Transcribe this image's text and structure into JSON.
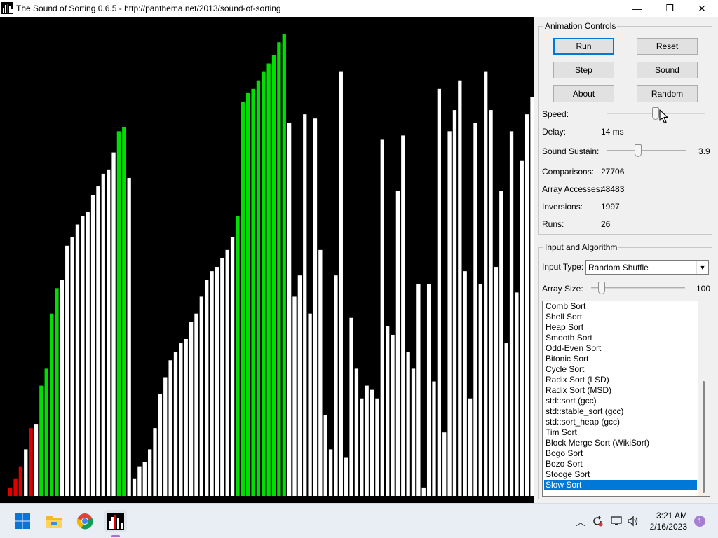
{
  "window": {
    "title": "The Sound of Sorting 0.6.5 - http://panthema.net/2013/sound-of-sorting",
    "minimize": "—",
    "restore": "❐",
    "close": "✕"
  },
  "colors": {
    "bar_default": "#ffffff",
    "bar_red": "#e00000",
    "bar_green": "#00e000",
    "accent": "#0078d7"
  },
  "visualization": {
    "bars": [
      {
        "v": 2,
        "c": "red"
      },
      {
        "v": 4,
        "c": "red"
      },
      {
        "v": 7,
        "c": "red"
      },
      {
        "v": 11,
        "c": "white"
      },
      {
        "v": 16,
        "c": "red"
      },
      {
        "v": 17,
        "c": "white"
      },
      {
        "v": 26,
        "c": "green"
      },
      {
        "v": 30,
        "c": "green"
      },
      {
        "v": 43,
        "c": "green"
      },
      {
        "v": 49,
        "c": "green"
      },
      {
        "v": 51,
        "c": "white"
      },
      {
        "v": 59,
        "c": "white"
      },
      {
        "v": 61,
        "c": "white"
      },
      {
        "v": 64,
        "c": "white"
      },
      {
        "v": 66,
        "c": "white"
      },
      {
        "v": 67,
        "c": "white"
      },
      {
        "v": 71,
        "c": "white"
      },
      {
        "v": 73,
        "c": "white"
      },
      {
        "v": 76,
        "c": "white"
      },
      {
        "v": 77,
        "c": "white"
      },
      {
        "v": 81,
        "c": "white"
      },
      {
        "v": 86,
        "c": "green"
      },
      {
        "v": 87,
        "c": "green"
      },
      {
        "v": 75,
        "c": "white"
      },
      {
        "v": 4,
        "c": "white"
      },
      {
        "v": 7,
        "c": "white"
      },
      {
        "v": 8,
        "c": "white"
      },
      {
        "v": 11,
        "c": "white"
      },
      {
        "v": 16,
        "c": "white"
      },
      {
        "v": 24,
        "c": "white"
      },
      {
        "v": 28,
        "c": "white"
      },
      {
        "v": 32,
        "c": "white"
      },
      {
        "v": 34,
        "c": "white"
      },
      {
        "v": 36,
        "c": "white"
      },
      {
        "v": 37,
        "c": "white"
      },
      {
        "v": 41,
        "c": "white"
      },
      {
        "v": 43,
        "c": "white"
      },
      {
        "v": 47,
        "c": "white"
      },
      {
        "v": 51,
        "c": "white"
      },
      {
        "v": 53,
        "c": "white"
      },
      {
        "v": 54,
        "c": "white"
      },
      {
        "v": 56,
        "c": "white"
      },
      {
        "v": 58,
        "c": "white"
      },
      {
        "v": 61,
        "c": "white"
      },
      {
        "v": 66,
        "c": "green"
      },
      {
        "v": 93,
        "c": "green"
      },
      {
        "v": 95,
        "c": "green"
      },
      {
        "v": 96,
        "c": "green"
      },
      {
        "v": 98,
        "c": "green"
      },
      {
        "v": 100,
        "c": "green"
      },
      {
        "v": 102,
        "c": "green"
      },
      {
        "v": 104,
        "c": "green"
      },
      {
        "v": 107,
        "c": "green"
      },
      {
        "v": 109,
        "c": "green"
      },
      {
        "v": 88,
        "c": "white"
      },
      {
        "v": 47,
        "c": "white"
      },
      {
        "v": 52,
        "c": "white"
      },
      {
        "v": 90,
        "c": "white"
      },
      {
        "v": 43,
        "c": "white"
      },
      {
        "v": 89,
        "c": "white"
      },
      {
        "v": 58,
        "c": "white"
      },
      {
        "v": 19,
        "c": "white"
      },
      {
        "v": 11,
        "c": "white"
      },
      {
        "v": 52,
        "c": "white"
      },
      {
        "v": 100,
        "c": "white"
      },
      {
        "v": 9,
        "c": "white"
      },
      {
        "v": 42,
        "c": "white"
      },
      {
        "v": 30,
        "c": "white"
      },
      {
        "v": 23,
        "c": "white"
      },
      {
        "v": 26,
        "c": "white"
      },
      {
        "v": 25,
        "c": "white"
      },
      {
        "v": 23,
        "c": "white"
      },
      {
        "v": 84,
        "c": "white"
      },
      {
        "v": 40,
        "c": "white"
      },
      {
        "v": 38,
        "c": "white"
      },
      {
        "v": 72,
        "c": "white"
      },
      {
        "v": 85,
        "c": "white"
      },
      {
        "v": 34,
        "c": "white"
      },
      {
        "v": 30,
        "c": "white"
      },
      {
        "v": 50,
        "c": "white"
      },
      {
        "v": 2,
        "c": "white"
      },
      {
        "v": 50,
        "c": "white"
      },
      {
        "v": 27,
        "c": "white"
      },
      {
        "v": 96,
        "c": "white"
      },
      {
        "v": 15,
        "c": "white"
      },
      {
        "v": 86,
        "c": "white"
      },
      {
        "v": 91,
        "c": "white"
      },
      {
        "v": 98,
        "c": "white"
      },
      {
        "v": 53,
        "c": "white"
      },
      {
        "v": 23,
        "c": "white"
      },
      {
        "v": 88,
        "c": "white"
      },
      {
        "v": 50,
        "c": "white"
      },
      {
        "v": 100,
        "c": "white"
      },
      {
        "v": 91,
        "c": "white"
      },
      {
        "v": 54,
        "c": "white"
      },
      {
        "v": 72,
        "c": "white"
      },
      {
        "v": 36,
        "c": "white"
      },
      {
        "v": 86,
        "c": "white"
      },
      {
        "v": 48,
        "c": "white"
      },
      {
        "v": 79,
        "c": "white"
      },
      {
        "v": 90,
        "c": "white"
      },
      {
        "v": 94,
        "c": "white"
      }
    ],
    "max_value": 111
  },
  "animation_controls": {
    "title": "Animation Controls",
    "buttons": {
      "run": "Run",
      "reset": "Reset",
      "step": "Step",
      "sound": "Sound",
      "about": "About",
      "random": "Random"
    },
    "speed_label": "Speed:",
    "speed_fraction": 0.5,
    "delay_label": "Delay:",
    "delay_value": "14 ms",
    "sustain_label": "Sound Sustain:",
    "sustain_fraction": 0.38,
    "sustain_value": "3.9",
    "stats": [
      {
        "label": "Comparisons:",
        "value": "27706"
      },
      {
        "label": "Array Accesses:",
        "value": "48483"
      },
      {
        "label": "Inversions:",
        "value": "1997"
      },
      {
        "label": "Runs:",
        "value": "26"
      }
    ]
  },
  "input_algorithm": {
    "title": "Input and Algorithm",
    "input_type_label": "Input Type:",
    "input_type_value": "Random Shuffle",
    "array_size_label": "Array Size:",
    "array_size_fraction": 0.08,
    "array_size_value": "100",
    "algorithms": [
      "Comb Sort",
      "Shell Sort",
      "Heap Sort",
      "Smooth Sort",
      "Odd-Even Sort",
      "Bitonic Sort",
      "Cycle Sort",
      "Radix Sort (LSD)",
      "Radix Sort (MSD)",
      "std::sort (gcc)",
      "std::stable_sort (gcc)",
      "std::sort_heap (gcc)",
      "Tim Sort",
      "Block Merge Sort (WikiSort)",
      "Bogo Sort",
      "Bozo Sort",
      "Stooge Sort",
      "Slow Sort"
    ],
    "selected_index": 17
  },
  "taskbar": {
    "icons": [
      {
        "name": "windows-start-icon"
      },
      {
        "name": "file-explorer-icon"
      },
      {
        "name": "chrome-icon"
      },
      {
        "name": "sound-of-sorting-icon"
      }
    ],
    "tray": {
      "chevron": "︿",
      "time": "3:21 AM",
      "date": "2/16/2023",
      "notification_count": "1"
    }
  }
}
